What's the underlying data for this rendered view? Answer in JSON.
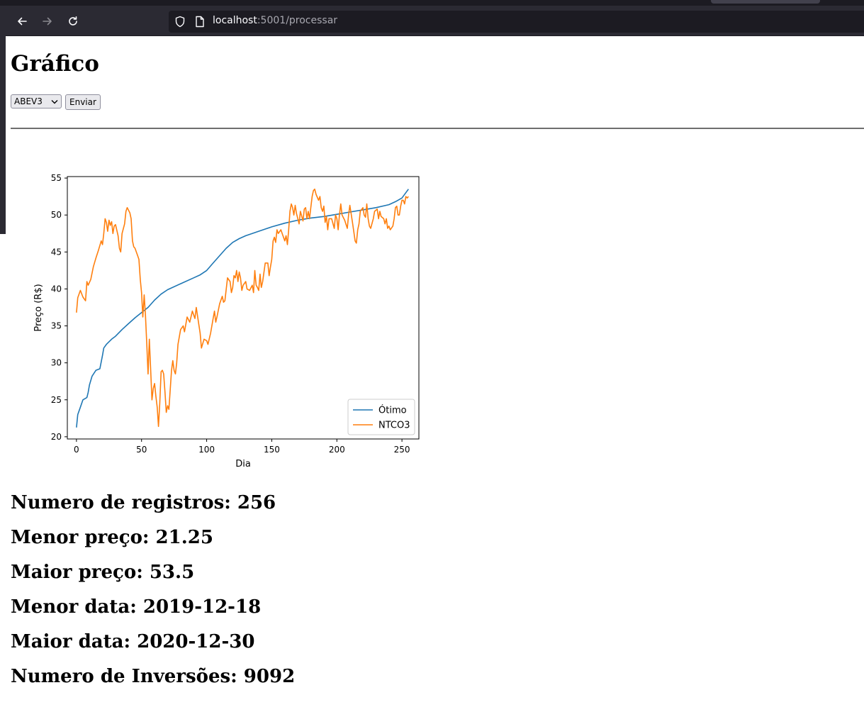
{
  "browser": {
    "url_host": "localhost",
    "url_rest": ":5001/processar"
  },
  "page": {
    "title": "Gráfico",
    "select_value": "ABEV3",
    "submit_label": "Enviar"
  },
  "chart_data": {
    "type": "line",
    "xlabel": "Dia",
    "ylabel": "Preço (R$)",
    "xlim": [
      -7,
      263
    ],
    "ylim": [
      19.7,
      55.2
    ],
    "xticks": [
      0,
      50,
      100,
      150,
      200,
      250
    ],
    "yticks": [
      20,
      25,
      30,
      35,
      40,
      45,
      50,
      55
    ],
    "legend_position": "lower right",
    "series": [
      {
        "name": "Ótimo",
        "color": "#1f77b4",
        "points": [
          [
            0,
            21.25
          ],
          [
            1,
            23
          ],
          [
            3,
            24
          ],
          [
            5,
            25
          ],
          [
            8,
            25.3
          ],
          [
            9,
            26
          ],
          [
            10,
            27
          ],
          [
            12,
            28.2
          ],
          [
            15,
            29
          ],
          [
            18,
            29.2
          ],
          [
            20,
            31
          ],
          [
            21,
            32
          ],
          [
            23,
            32.5
          ],
          [
            27,
            33.2
          ],
          [
            30,
            33.6
          ],
          [
            35,
            34.5
          ],
          [
            40,
            35.3
          ],
          [
            45,
            36.1
          ],
          [
            50,
            36.8
          ],
          [
            55,
            37.5
          ],
          [
            60,
            38.5
          ],
          [
            65,
            39.3
          ],
          [
            70,
            39.9
          ],
          [
            80,
            40.7
          ],
          [
            90,
            41.5
          ],
          [
            95,
            41.9
          ],
          [
            100,
            42.5
          ],
          [
            105,
            43.5
          ],
          [
            110,
            44.5
          ],
          [
            115,
            45.5
          ],
          [
            120,
            46.3
          ],
          [
            125,
            46.8
          ],
          [
            130,
            47.2
          ],
          [
            135,
            47.5
          ],
          [
            140,
            47.8
          ],
          [
            145,
            48.1
          ],
          [
            150,
            48.4
          ],
          [
            160,
            48.9
          ],
          [
            170,
            49.3
          ],
          [
            180,
            49.6
          ],
          [
            190,
            49.8
          ],
          [
            200,
            50.1
          ],
          [
            210,
            50.4
          ],
          [
            220,
            50.7
          ],
          [
            230,
            51
          ],
          [
            240,
            51.4
          ],
          [
            245,
            51.8
          ],
          [
            250,
            52.3
          ],
          [
            255,
            53.5
          ]
        ]
      },
      {
        "name": "NTCO3",
        "color": "#ff7f0e",
        "points": [
          [
            0,
            36.8
          ],
          [
            1,
            38.8
          ],
          [
            3,
            39.8
          ],
          [
            5,
            38.9
          ],
          [
            7,
            38.4
          ],
          [
            8,
            41
          ],
          [
            9,
            40.5
          ],
          [
            11,
            41.3
          ],
          [
            13,
            43
          ],
          [
            15,
            44.2
          ],
          [
            17,
            45.3
          ],
          [
            19,
            46.5
          ],
          [
            20,
            46
          ],
          [
            21,
            47.5
          ],
          [
            22,
            49.5
          ],
          [
            23,
            49
          ],
          [
            24,
            47.8
          ],
          [
            25,
            49.3
          ],
          [
            26,
            48.6
          ],
          [
            27,
            49.1
          ],
          [
            28,
            47.5
          ],
          [
            29,
            48.5
          ],
          [
            30,
            48.7
          ],
          [
            32,
            47.2
          ],
          [
            33,
            45.5
          ],
          [
            34,
            45
          ],
          [
            35,
            47.5
          ],
          [
            37,
            48.8
          ],
          [
            38,
            50.5
          ],
          [
            39,
            51
          ],
          [
            41,
            50.3
          ],
          [
            42,
            49.5
          ],
          [
            43,
            46.5
          ],
          [
            44,
            45.7
          ],
          [
            45,
            45.5
          ],
          [
            47,
            44.5
          ],
          [
            48,
            44
          ],
          [
            49,
            41.3
          ],
          [
            50,
            39.5
          ],
          [
            51,
            36.2
          ],
          [
            52,
            39.2
          ],
          [
            53,
            36.5
          ],
          [
            54,
            32.5
          ],
          [
            55,
            28.5
          ],
          [
            56,
            33.2
          ],
          [
            57,
            29
          ],
          [
            58,
            25
          ],
          [
            59,
            26.5
          ],
          [
            60,
            27.2
          ],
          [
            61,
            25.5
          ],
          [
            62,
            24
          ],
          [
            63,
            21.4
          ],
          [
            64,
            24.5
          ],
          [
            65,
            28.8
          ],
          [
            66,
            29
          ],
          [
            67,
            28.5
          ],
          [
            68,
            26
          ],
          [
            69,
            23.3
          ],
          [
            70,
            24.2
          ],
          [
            71,
            23.7
          ],
          [
            73,
            29
          ],
          [
            74,
            30.3
          ],
          [
            75,
            29
          ],
          [
            76,
            28.5
          ],
          [
            77,
            30
          ],
          [
            78,
            32.5
          ],
          [
            80,
            34.5
          ],
          [
            82,
            35
          ],
          [
            83,
            34.2
          ],
          [
            85,
            36.2
          ],
          [
            87,
            35.5
          ],
          [
            89,
            37
          ],
          [
            91,
            36
          ],
          [
            92,
            37.5
          ],
          [
            94,
            35.2
          ],
          [
            95,
            34
          ],
          [
            96,
            32
          ],
          [
            98,
            33.2
          ],
          [
            100,
            33
          ],
          [
            101,
            32.5
          ],
          [
            103,
            34
          ],
          [
            105,
            36
          ],
          [
            106,
            37
          ],
          [
            107,
            35.5
          ],
          [
            108,
            36.3
          ],
          [
            110,
            38
          ],
          [
            112,
            39
          ],
          [
            113,
            38.2
          ],
          [
            114,
            38.4
          ],
          [
            116,
            41.5
          ],
          [
            118,
            41
          ],
          [
            119,
            39.5
          ],
          [
            120,
            40.2
          ],
          [
            121,
            41.8
          ],
          [
            122,
            41.5
          ],
          [
            123,
            42.5
          ],
          [
            124,
            41
          ],
          [
            125,
            42.3
          ],
          [
            126,
            41.5
          ],
          [
            127,
            39.8
          ],
          [
            128,
            40.5
          ],
          [
            130,
            41
          ],
          [
            131,
            40
          ],
          [
            133,
            39.8
          ],
          [
            135,
            40.5
          ],
          [
            136,
            39.5
          ],
          [
            137,
            42.5
          ],
          [
            138,
            40.5
          ],
          [
            139,
            40.2
          ],
          [
            140,
            39.8
          ],
          [
            141,
            42
          ],
          [
            142,
            40.2
          ],
          [
            143,
            41
          ],
          [
            145,
            43.5
          ],
          [
            147,
            43.5
          ],
          [
            148,
            41.8
          ],
          [
            149,
            43
          ],
          [
            150,
            44
          ],
          [
            151,
            46.5
          ],
          [
            152,
            47
          ],
          [
            153,
            46.3
          ],
          [
            154,
            48
          ],
          [
            155,
            47.5
          ],
          [
            157,
            48
          ],
          [
            158,
            47.5
          ],
          [
            160,
            46.5
          ],
          [
            161,
            47.2
          ],
          [
            162,
            46
          ],
          [
            163,
            48
          ],
          [
            164,
            50.5
          ],
          [
            165,
            51.5
          ],
          [
            166,
            51
          ],
          [
            167,
            50
          ],
          [
            168,
            51.3
          ],
          [
            169,
            50.2
          ],
          [
            170,
            49.5
          ],
          [
            171,
            48.8
          ],
          [
            172,
            50.5
          ],
          [
            174,
            49.2
          ],
          [
            175,
            50.8
          ],
          [
            176,
            51
          ],
          [
            177,
            49.5
          ],
          [
            178,
            50.5
          ],
          [
            179,
            49.5
          ],
          [
            180,
            51
          ],
          [
            181,
            52.5
          ],
          [
            182,
            53.3
          ],
          [
            183,
            53.5
          ],
          [
            184,
            52.8
          ],
          [
            186,
            52
          ],
          [
            187,
            52.5
          ],
          [
            188,
            51
          ],
          [
            189,
            50.5
          ],
          [
            190,
            51.2
          ],
          [
            191,
            49
          ],
          [
            192,
            49.8
          ],
          [
            193,
            48
          ],
          [
            194,
            49.5
          ],
          [
            196,
            49.5
          ],
          [
            198,
            48.2
          ],
          [
            199,
            50
          ],
          [
            200,
            49.5
          ],
          [
            201,
            48
          ],
          [
            202,
            50
          ],
          [
            203,
            51.5
          ],
          [
            204,
            50
          ],
          [
            206,
            49.3
          ],
          [
            208,
            48.2
          ],
          [
            209,
            50
          ],
          [
            210,
            51.3
          ],
          [
            212,
            49
          ],
          [
            213,
            47.8
          ],
          [
            214,
            46.5
          ],
          [
            215,
            46.2
          ],
          [
            216,
            48
          ],
          [
            217,
            48.8
          ],
          [
            218,
            50.5
          ],
          [
            220,
            51
          ],
          [
            221,
            50
          ],
          [
            222,
            49.7
          ],
          [
            223,
            51.5
          ],
          [
            224,
            49.5
          ],
          [
            225,
            48.5
          ],
          [
            226,
            48.2
          ],
          [
            228,
            49.5
          ],
          [
            229,
            50.5
          ],
          [
            231,
            50.8
          ],
          [
            232,
            49.5
          ],
          [
            233,
            50.5
          ],
          [
            234,
            49.8
          ],
          [
            236,
            49.5
          ],
          [
            237,
            48.8
          ],
          [
            238,
            49.5
          ],
          [
            239,
            48.2
          ],
          [
            240,
            48.5
          ],
          [
            241,
            48
          ],
          [
            243,
            48.5
          ],
          [
            244,
            49.5
          ],
          [
            245,
            51
          ],
          [
            246,
            51.2
          ],
          [
            247,
            50
          ],
          [
            248,
            50
          ],
          [
            249,
            51.2
          ],
          [
            250,
            52
          ],
          [
            251,
            52
          ],
          [
            252,
            51.5
          ],
          [
            253,
            52.5
          ],
          [
            254,
            52.3
          ],
          [
            255,
            52.5
          ]
        ]
      }
    ]
  },
  "stats": [
    "Numero de registros: 256",
    "Menor preço: 21.25",
    "Maior preço: 53.5",
    "Menor data: 2019-12-18",
    "Maior data: 2020-12-30",
    "Numero de Inversões: 9092"
  ]
}
